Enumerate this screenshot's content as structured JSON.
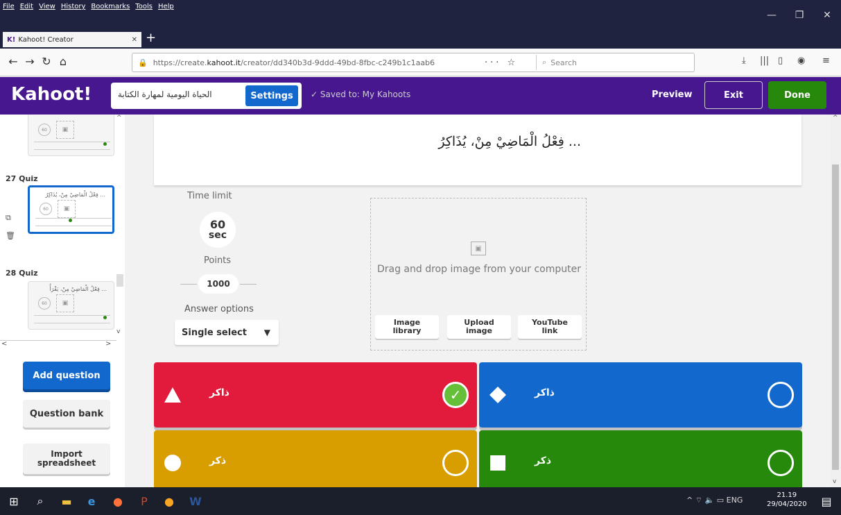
{
  "browser": {
    "menu": [
      "File",
      "Edit",
      "View",
      "History",
      "Bookmarks",
      "Tools",
      "Help"
    ],
    "tab_title": "Kahoot! Creator",
    "tab_icon": "K!",
    "url_prefix": "https://create.",
    "url_domain": "kahoot.it",
    "url_path": "/creator/dd340b3d-9ddd-49bd-8fbc-c249b1c1aab6",
    "search_placeholder": "Search"
  },
  "header": {
    "logo": "Kahoot!",
    "kahoot_title": "الحياة اليومية لمهارة الكتابة",
    "settings_label": "Settings",
    "saved_status": "Saved to: My Kahoots",
    "preview_label": "Preview",
    "exit_label": "Exit",
    "done_label": "Done"
  },
  "sidebar": {
    "slides": [
      {
        "number": "27",
        "type": "Quiz",
        "preview_text": "فِعْلُ الْمَاضِيْ مِنْ، يُذَاكِرُ ...",
        "time": "60"
      },
      {
        "number": "28",
        "type": "Quiz",
        "preview_text": "فِعْلُ الْمَاضِيْ مِنْ، يَقْرَأُ ...",
        "time": "60"
      }
    ],
    "prev_slide_time": "60",
    "add_question": "Add question",
    "question_bank": "Question bank",
    "import_line1": "Import",
    "import_line2": "spreadsheet"
  },
  "editor": {
    "question": "فِعْلُ الْمَاضِيْ مِنْ، يُذَاكِرُ ...",
    "time_limit_label": "Time limit",
    "time_value": "60",
    "time_unit": "sec",
    "points_label": "Points",
    "points_value": "1000",
    "answer_options_label": "Answer options",
    "answer_mode": "Single select",
    "media_text": "Drag and drop image from your computer",
    "media_buttons": [
      {
        "l1": "Image",
        "l2": "library"
      },
      {
        "l1": "Upload",
        "l2": "image"
      },
      {
        "l1": "YouTube",
        "l2": "link"
      }
    ],
    "answers": [
      {
        "text": "ذاكر",
        "color": "#e21b3c",
        "shape": "triangle",
        "correct": true
      },
      {
        "text": "ذاكر",
        "color": "#1368ce",
        "shape": "diamond",
        "correct": false
      },
      {
        "text": "ذكر",
        "color": "#d89e00",
        "shape": "circle",
        "correct": false
      },
      {
        "text": "ذكر",
        "color": "#26890c",
        "shape": "square",
        "correct": false
      }
    ]
  },
  "taskbar": {
    "lang": "ENG",
    "time": "21.19",
    "date": "29/04/2020"
  }
}
